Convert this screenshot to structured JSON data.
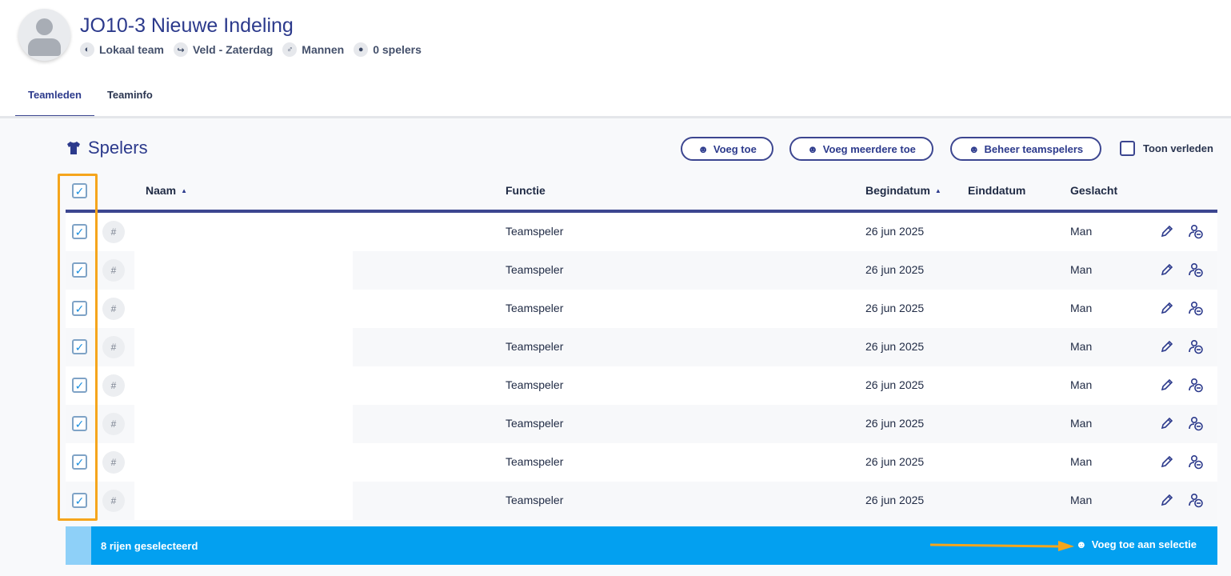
{
  "team": {
    "title": "JO10-3 Nieuwe Indeling",
    "meta": [
      {
        "icon": "shield-icon",
        "label": "Lokaal team"
      },
      {
        "icon": "runner-icon",
        "label": "Veld - Zaterdag"
      },
      {
        "icon": "male-icon",
        "label": "Mannen"
      },
      {
        "icon": "players-icon",
        "label": "0 spelers"
      }
    ]
  },
  "tabs": [
    {
      "label": "Teamleden",
      "active": true
    },
    {
      "label": "Teaminfo",
      "active": false
    }
  ],
  "section": {
    "title": "Spelers",
    "buttons": {
      "add": "Voeg toe",
      "add_multiple": "Voeg meerdere toe",
      "manage": "Beheer teamspelers"
    },
    "show_past_label": "Toon verleden"
  },
  "table": {
    "headers": {
      "name": "Naam",
      "function": "Functie",
      "start_date": "Begindatum",
      "end_date": "Einddatum",
      "gender": "Geslacht"
    },
    "rows": [
      {
        "number": "#",
        "name": "",
        "function": "Teamspeler",
        "start_date": "26 jun 2025",
        "end_date": "",
        "gender": "Man",
        "selected": true
      },
      {
        "number": "#",
        "name": "",
        "function": "Teamspeler",
        "start_date": "26 jun 2025",
        "end_date": "",
        "gender": "Man",
        "selected": true
      },
      {
        "number": "#",
        "name": "",
        "function": "Teamspeler",
        "start_date": "26 jun 2025",
        "end_date": "",
        "gender": "Man",
        "selected": true
      },
      {
        "number": "#",
        "name": "",
        "function": "Teamspeler",
        "start_date": "26 jun 2025",
        "end_date": "",
        "gender": "Man",
        "selected": true
      },
      {
        "number": "#",
        "name": "",
        "function": "Teamspeler",
        "start_date": "26 jun 2025",
        "end_date": "",
        "gender": "Man",
        "selected": true
      },
      {
        "number": "#",
        "name": "",
        "function": "Teamspeler",
        "start_date": "26 jun 2025",
        "end_date": "",
        "gender": "Man",
        "selected": true
      },
      {
        "number": "#",
        "name": "",
        "function": "Teamspeler",
        "start_date": "26 jun 2025",
        "end_date": "",
        "gender": "Man",
        "selected": true
      },
      {
        "number": "#",
        "name": "",
        "function": "Teamspeler",
        "start_date": "26 jun 2025",
        "end_date": "",
        "gender": "Man",
        "selected": true
      }
    ]
  },
  "selection": {
    "count_label": "8 rijen geselecteerd",
    "action_label": "Voeg toe aan selectie"
  },
  "colors": {
    "primary": "#2c3a8c",
    "selection_bar": "#03a0f0",
    "highlight": "#f5a51c",
    "checkbox_check": "#1a8fe0"
  }
}
